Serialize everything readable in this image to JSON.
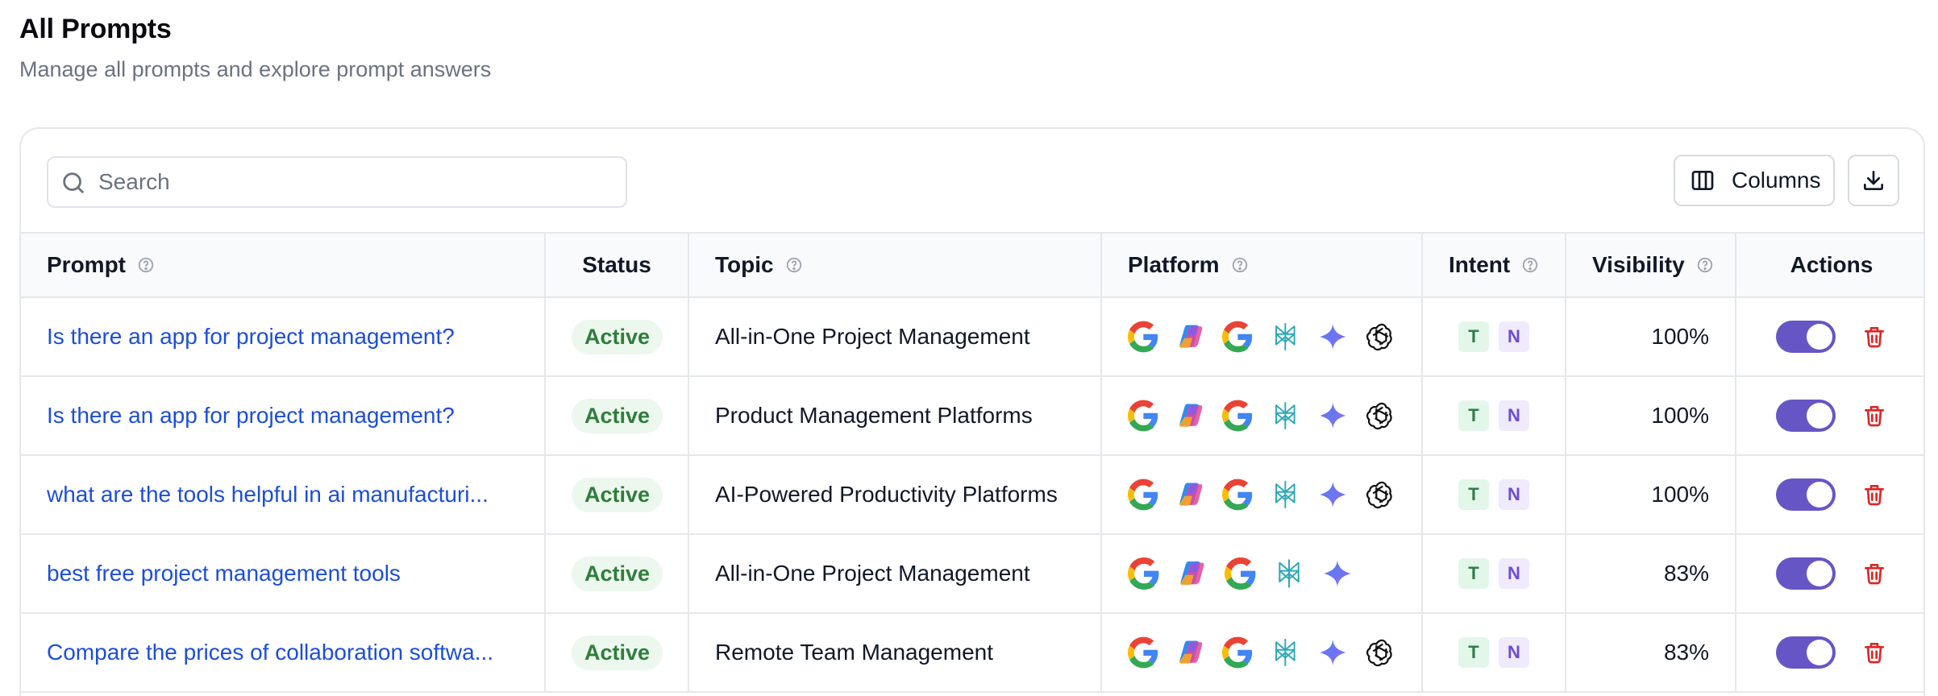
{
  "page": {
    "title": "All Prompts",
    "subtitle": "Manage all prompts and explore prompt answers"
  },
  "toolbar": {
    "search_placeholder": "Search",
    "search_value": "",
    "columns_label": "Columns"
  },
  "table": {
    "headers": {
      "prompt": "Prompt",
      "status": "Status",
      "topic": "Topic",
      "platform": "Platform",
      "intent": "Intent",
      "visibility": "Visibility",
      "actions": "Actions"
    },
    "rows": [
      {
        "prompt": "Is there an app for project management?",
        "status": "Active",
        "topic": "All-in-One Project Management",
        "platforms": [
          "google",
          "copilot",
          "google",
          "perplexity",
          "gemini",
          "chatgpt"
        ],
        "intent_t": "T",
        "intent_n": "N",
        "visibility": "100%",
        "enabled": true
      },
      {
        "prompt": "Is there an app for project management?",
        "status": "Active",
        "topic": "Product Management Platforms",
        "platforms": [
          "google",
          "copilot",
          "google",
          "perplexity",
          "gemini",
          "chatgpt"
        ],
        "intent_t": "T",
        "intent_n": "N",
        "visibility": "100%",
        "enabled": true
      },
      {
        "prompt": "what are the tools helpful in ai manufacturi...",
        "status": "Active",
        "topic": "AI-Powered Productivity Platforms",
        "platforms": [
          "google",
          "copilot",
          "google",
          "perplexity",
          "gemini",
          "chatgpt"
        ],
        "intent_t": "T",
        "intent_n": "N",
        "visibility": "100%",
        "enabled": true
      },
      {
        "prompt": "best free project management tools",
        "status": "Active",
        "topic": "All-in-One Project Management",
        "platforms": [
          "google",
          "copilot",
          "google",
          "perplexity",
          "gemini"
        ],
        "intent_t": "T",
        "intent_n": "N",
        "visibility": "83%",
        "enabled": true
      },
      {
        "prompt": "Compare the prices of collaboration softwa...",
        "status": "Active",
        "topic": "Remote Team Management",
        "platforms": [
          "google",
          "copilot",
          "google",
          "perplexity",
          "gemini",
          "chatgpt"
        ],
        "intent_t": "T",
        "intent_n": "N",
        "visibility": "83%",
        "enabled": true
      }
    ]
  },
  "colors": {
    "link": "#1d4ed8",
    "status_bg": "#ecf7ee",
    "status_text": "#2f7d3a",
    "toggle_on": "#6655c5",
    "delete": "#dc2626"
  },
  "icons": {
    "search": "search-icon",
    "columns": "columns-icon",
    "download": "download-icon",
    "help": "help-circle-icon",
    "delete": "trash-icon"
  }
}
